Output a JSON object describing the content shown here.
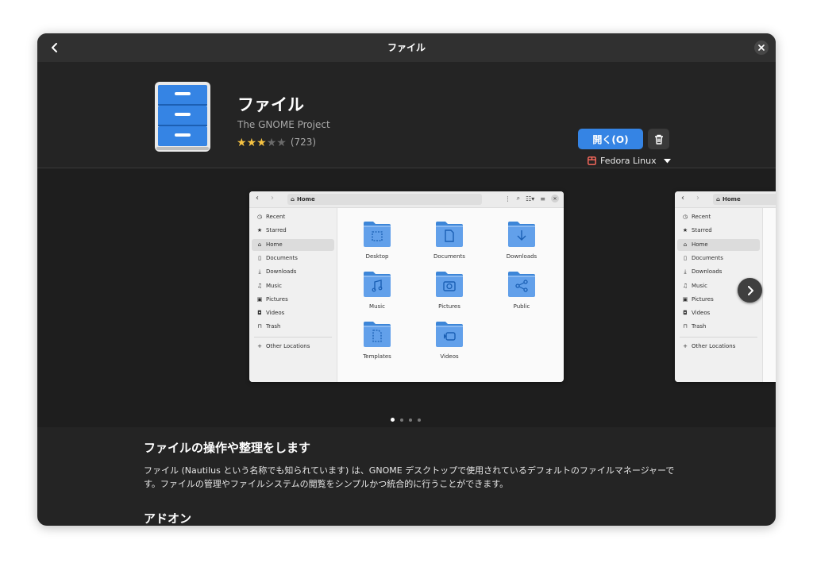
{
  "window": {
    "title": "ファイル"
  },
  "app": {
    "name": "ファイル",
    "developer": "The GNOME Project",
    "rating_stars": 3,
    "rating_max": 5,
    "rating_count": "(723)",
    "open_label": "開く(O)",
    "source_label": "Fedora Linux",
    "icon_color": "#3584e4"
  },
  "screenshot": {
    "path_label": "Home",
    "sidebar": [
      {
        "label": "Recent",
        "icon": "clock-icon"
      },
      {
        "label": "Starred",
        "icon": "star-icon"
      },
      {
        "label": "Home",
        "icon": "home-icon"
      },
      {
        "label": "Documents",
        "icon": "document-icon"
      },
      {
        "label": "Downloads",
        "icon": "download-icon"
      },
      {
        "label": "Music",
        "icon": "music-icon"
      },
      {
        "label": "Pictures",
        "icon": "picture-icon"
      },
      {
        "label": "Videos",
        "icon": "video-icon"
      },
      {
        "label": "Trash",
        "icon": "trash-icon"
      }
    ],
    "other_locations": "Other Locations",
    "folders": [
      {
        "label": "Desktop",
        "icon": "desktop-icon"
      },
      {
        "label": "Documents",
        "icon": "document-icon"
      },
      {
        "label": "Downloads",
        "icon": "download-icon"
      },
      {
        "label": "Music",
        "icon": "music-icon"
      },
      {
        "label": "Pictures",
        "icon": "camera-icon"
      },
      {
        "label": "Public",
        "icon": "share-icon"
      },
      {
        "label": "Templates",
        "icon": "template-icon"
      },
      {
        "label": "Videos",
        "icon": "video-icon"
      }
    ]
  },
  "gallery": {
    "page_count": 4,
    "active_page": 1
  },
  "description": {
    "title": "ファイルの操作や整理をします",
    "body": "ファイル (Nautilus という名称でも知られています) は、GNOME デスクトップで使用されているデフォルトのファイルマネージャーです。ファイルの管理やファイルシステムの閲覧をシンプルかつ統合的に行うことができます。"
  },
  "addons": {
    "title": "アドオン"
  },
  "colors": {
    "accent": "#3584e4",
    "window_bg": "#242424",
    "headerbar_bg": "#303030",
    "star": "#f6c343",
    "folder_blue": "#62a0ea"
  }
}
